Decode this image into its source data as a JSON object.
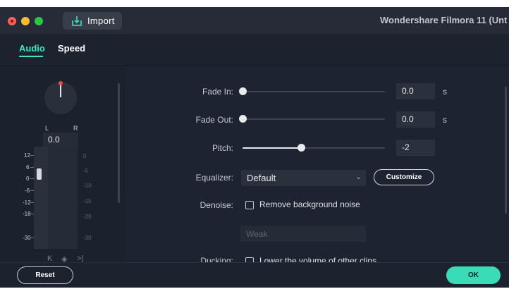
{
  "window": {
    "title": "Wondershare Filmora 11 (Unt",
    "import_label": "Import"
  },
  "tabs": [
    {
      "label": "Audio",
      "active": true
    },
    {
      "label": "Speed",
      "active": false
    }
  ],
  "colors": {
    "accent": "#3ee6c7",
    "ok_button": "#39dcb6",
    "pan_indicator": "#f04b47"
  },
  "pan": {
    "left_label": "L",
    "right_label": "R",
    "value": "0.0"
  },
  "meter": {
    "left_scale": [
      "12",
      "6",
      "0",
      "-6",
      "-12",
      "-18",
      "-30"
    ],
    "right_scale": [
      "0",
      "-5",
      "-10",
      "-15",
      "-20",
      "-30"
    ],
    "transport_icons": [
      "keyframe-prev-icon",
      "keyframe-add-icon",
      "keyframe-next-icon"
    ],
    "transport_glyphs": [
      "K",
      "◈",
      ">|"
    ]
  },
  "settings": {
    "fade_in": {
      "label": "Fade In:",
      "value": "0.0",
      "unit": "s",
      "level": 0
    },
    "fade_out": {
      "label": "Fade Out:",
      "value": "0.0",
      "unit": "s",
      "level": 0
    },
    "pitch": {
      "label": "Pitch:",
      "value": "-2",
      "level": 0.41
    },
    "equalizer": {
      "label": "Equalizer:",
      "selected": "Default",
      "customize_label": "Customize"
    },
    "denoise": {
      "label": "Denoise:",
      "checkbox_label": "Remove background noise",
      "checked": false,
      "level_placeholder": "Weak"
    },
    "ducking": {
      "label": "Ducking:",
      "checkbox_label": "Lower the volume of other clips",
      "checked": false
    }
  },
  "footer": {
    "reset_label": "Reset",
    "ok_label": "OK"
  }
}
